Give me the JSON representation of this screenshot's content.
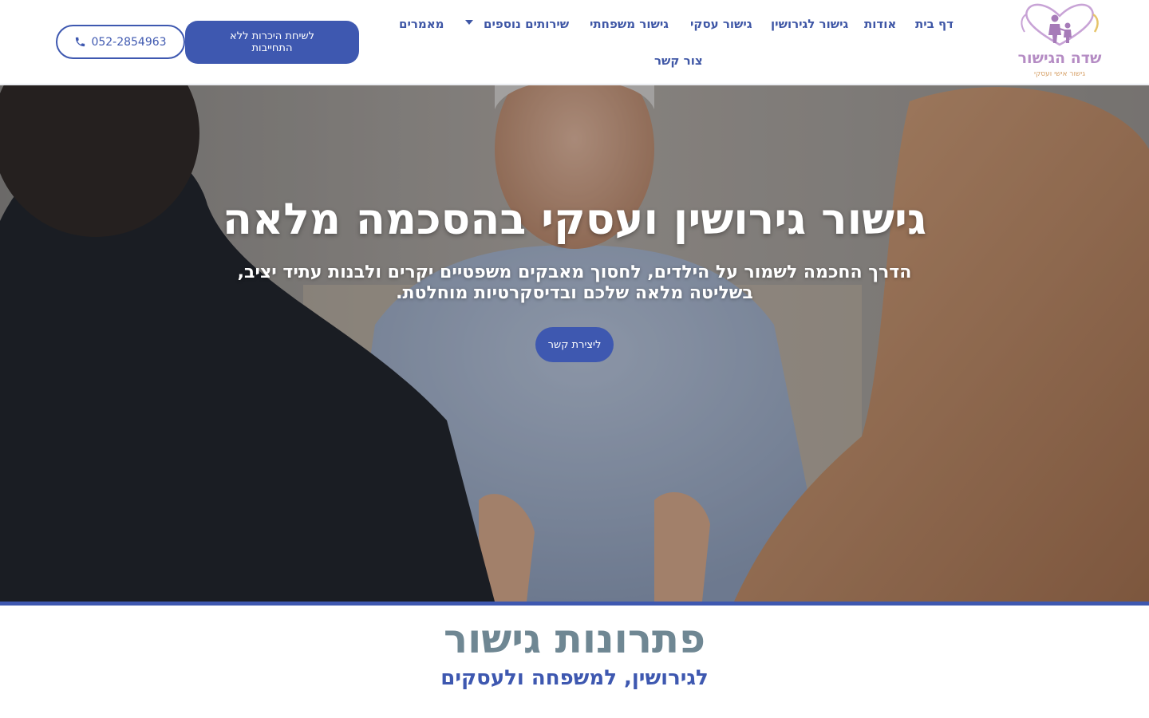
{
  "header": {
    "logo": {
      "name": "שדה הגישור",
      "tagline": "גישור אישי ועסקי"
    },
    "nav": {
      "items": [
        "דף בית",
        "אודות",
        "גישור לגירושין",
        "גישור עסקי",
        "גישור משפחתי",
        "שירותים נוספים",
        "מאמרים",
        "צור קשר"
      ]
    },
    "cta_label": "לשיחת היכרות ללא התחייבות",
    "phone": "052-2854963"
  },
  "hero": {
    "title": "גישור גירושין ועסקי בהסכמה מלאה",
    "subtitle": "הדרך החכמה לשמור על הילדים, לחסוך מאבקים משפטיים יקרים ולבנות עתיד יציב, בשליטה מלאה שלכם ובדיסקרטיות מוחלטת.",
    "button_label": "ליצירת קשר"
  },
  "solutions": {
    "title": "פתרונות גישור",
    "subtitle": "לגירושין, למשפחה ולעסקים"
  },
  "colors": {
    "brand_blue": "#3e58b0",
    "nav_text": "#3f57a6",
    "section_title": "#6f8793",
    "logo_purple": "#b58cc4",
    "logo_orange": "#d7a26a"
  },
  "icons": [
    "logo-heart-family-icon",
    "phone-icon",
    "chevron-down-icon"
  ]
}
